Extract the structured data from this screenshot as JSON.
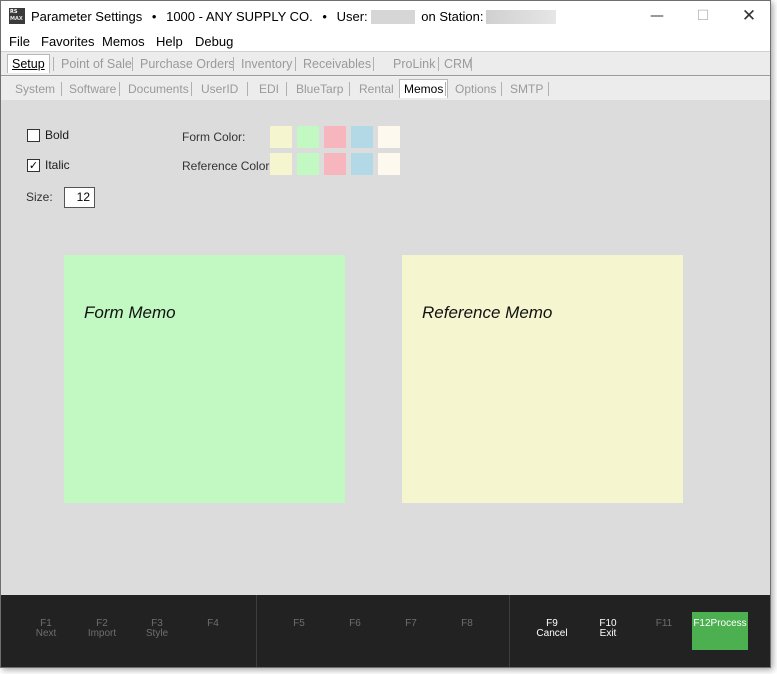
{
  "titlebar": {
    "app_icon_top": "RS",
    "app_icon_bottom": "MAX",
    "window_name": "Parameter Settings",
    "company": "1000 - ANY SUPPLY CO.",
    "user_label": "User:",
    "station_label": "on Station:",
    "bullet": "•",
    "minimize": "—",
    "maximize": "☐",
    "close": "✕"
  },
  "menubar": {
    "items": [
      "File",
      "Favorites",
      "Memos",
      "Help",
      "Debug"
    ]
  },
  "tabs_primary": [
    "Setup",
    "Point of Sale",
    "Purchase Orders",
    "Inventory",
    "Receivables",
    "ProLink",
    "CRM"
  ],
  "tabs_secondary": [
    "System",
    "Software",
    "Documents",
    "UserID",
    "EDI",
    "BlueTarp",
    "Rental",
    "Memos",
    "Options",
    "SMTP"
  ],
  "active_primary_tab": "Setup",
  "active_secondary_tab": "Memos",
  "options": {
    "bold_label": "Bold",
    "bold_checked": false,
    "italic_label": "Italic",
    "italic_checked": true,
    "check_mark": "✓",
    "size_label": "Size:",
    "size_value": "12",
    "form_color_label": "Form Color:",
    "reference_color_label": "Reference Color:"
  },
  "swatch_colors": [
    "#f5f5d0",
    "#c2f8c2",
    "#f7b5bd",
    "#b3d9e6",
    "#fdf9ee"
  ],
  "memos": {
    "form_label": "Form Memo",
    "form_color": "#c2f8c2",
    "reference_label": "Reference Memo",
    "reference_color": "#f5f5d0"
  },
  "function_keys": [
    {
      "key": "F1",
      "label": "Next",
      "enabled": false
    },
    {
      "key": "F2",
      "label": "Import",
      "enabled": false
    },
    {
      "key": "F3",
      "label": "Style",
      "enabled": false
    },
    {
      "key": "F4",
      "label": "",
      "enabled": false
    },
    {
      "key": "F5",
      "label": "",
      "enabled": false
    },
    {
      "key": "F6",
      "label": "",
      "enabled": false
    },
    {
      "key": "F7",
      "label": "",
      "enabled": false
    },
    {
      "key": "F8",
      "label": "",
      "enabled": false
    },
    {
      "key": "F9",
      "label": "Cancel",
      "enabled": true
    },
    {
      "key": "F10",
      "label": "Exit",
      "enabled": true
    },
    {
      "key": "F11",
      "label": "",
      "enabled": false
    },
    {
      "key": "F12",
      "label": "Process",
      "enabled": true
    }
  ],
  "colors": {
    "process_button": "#4caf50",
    "fkey_bar": "#222222"
  }
}
